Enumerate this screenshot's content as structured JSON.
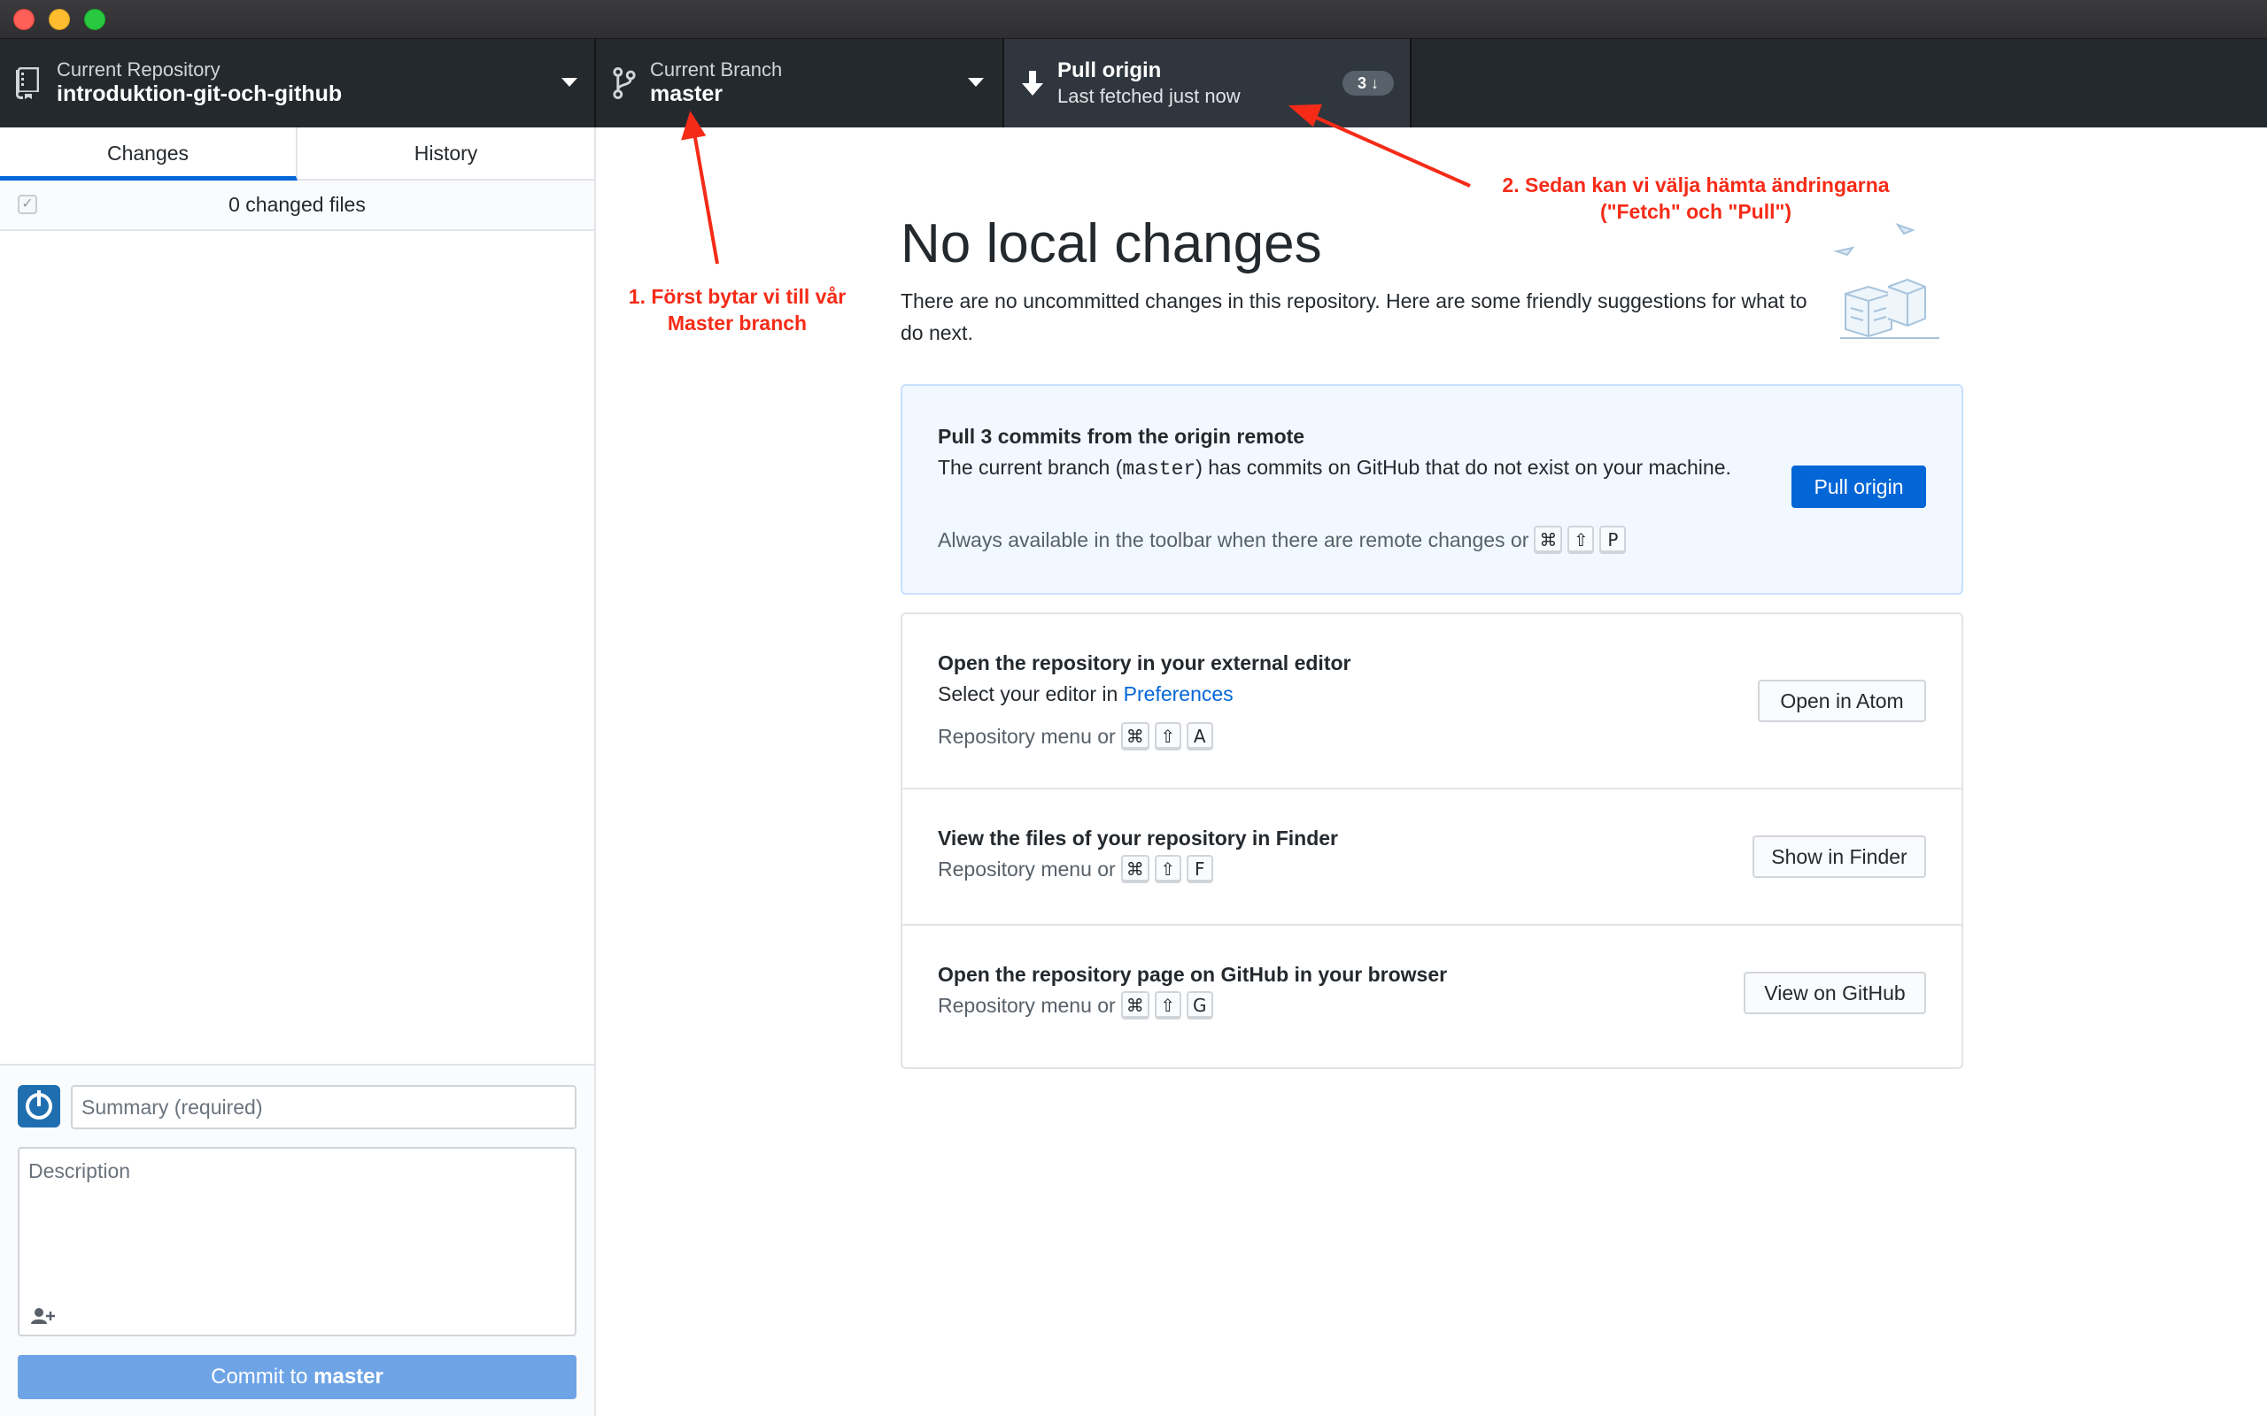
{
  "window": {
    "traffic_lights": [
      "close",
      "minimize",
      "zoom"
    ]
  },
  "toolbar": {
    "repository": {
      "label": "Current Repository",
      "value": "introduktion-git-och-github",
      "icon": "repo-icon"
    },
    "branch": {
      "label": "Current Branch",
      "value": "master",
      "icon": "branch-icon"
    },
    "pull": {
      "title": "Pull origin",
      "subtitle": "Last fetched just now",
      "badge": "3 ↓",
      "icon": "arrow-down-icon"
    }
  },
  "sidebar": {
    "tabs": [
      {
        "label": "Changes",
        "selected": true
      },
      {
        "label": "History",
        "selected": false
      }
    ],
    "changed_files": "0 changed files",
    "summary_placeholder": "Summary (required)",
    "description_placeholder": "Description",
    "commit_button": {
      "prefix": "Commit to ",
      "branch": "master"
    }
  },
  "main": {
    "heading": "No local changes",
    "intro": "There are no uncommitted changes in this repository. Here are some friendly suggestions for what to do next.",
    "pull_card": {
      "title": "Pull 3 commits from the origin remote",
      "text_before": "The current branch (",
      "branch_code": "master",
      "text_after": ") has commits on GitHub that do not exist on your machine.",
      "hint": "Always available in the toolbar when there are remote changes or",
      "keys": [
        "⌘",
        "⇧",
        "P"
      ],
      "button": "Pull origin"
    },
    "editor_card": {
      "title": "Open the repository in your external editor",
      "text": "Select your editor in",
      "link": "Preferences",
      "hint": "Repository menu or",
      "keys": [
        "⌘",
        "⇧",
        "A"
      ],
      "button": "Open in Atom"
    },
    "finder_card": {
      "title": "View the files of your repository in Finder",
      "hint": "Repository menu or",
      "keys": [
        "⌘",
        "⇧",
        "F"
      ],
      "button": "Show in Finder"
    },
    "github_card": {
      "title": "Open the repository page on GitHub in your browser",
      "hint": "Repository menu or",
      "keys": [
        "⌘",
        "⇧",
        "G"
      ],
      "button": "View on GitHub"
    }
  },
  "annotations": {
    "first": {
      "line1": "1. Först bytar vi till vår",
      "line2": "Master branch"
    },
    "second": {
      "line1": "2. Sedan kan vi välja hämta ändringarna",
      "line2": "(\"Fetch\" och \"Pull\")"
    },
    "color": "#f52b18"
  },
  "colors": {
    "toolbar_bg": "#24292e",
    "accent_blue": "#0366d6",
    "commit_button": "#6ea4e6",
    "pull_card_bg": "#f1f8ff"
  }
}
